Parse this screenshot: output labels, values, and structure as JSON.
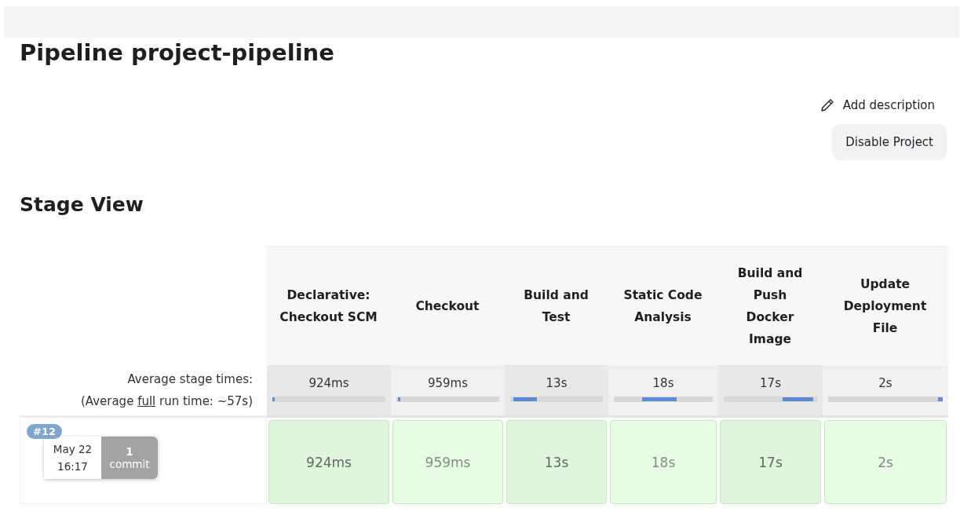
{
  "page_title": "Pipeline project-pipeline",
  "actions": {
    "add_description": "Add description",
    "disable_button": "Disable Project"
  },
  "section_title": "Stage View",
  "stage_view": {
    "average_label": "Average stage times:",
    "full_run_prefix": "(Average ",
    "full_run_link": "full",
    "full_run_suffix": " run time: ~57s)",
    "stages": [
      {
        "name": "Declarative: Checkout SCM",
        "average": "924ms"
      },
      {
        "name": "Checkout",
        "average": "959ms"
      },
      {
        "name": "Build and Test",
        "average": "13s"
      },
      {
        "name": "Static Code Analysis",
        "average": "18s"
      },
      {
        "name": "Build and Push Docker Image",
        "average": "17s"
      },
      {
        "name": "Update Deployment File",
        "average": "2s"
      }
    ],
    "builds": [
      {
        "number": "#12",
        "date": "May 22",
        "time": "16:17",
        "commit_count": "1",
        "commit_label": "commit",
        "durations": [
          "924ms",
          "959ms",
          "13s",
          "18s",
          "17s",
          "2s"
        ]
      }
    ]
  }
}
